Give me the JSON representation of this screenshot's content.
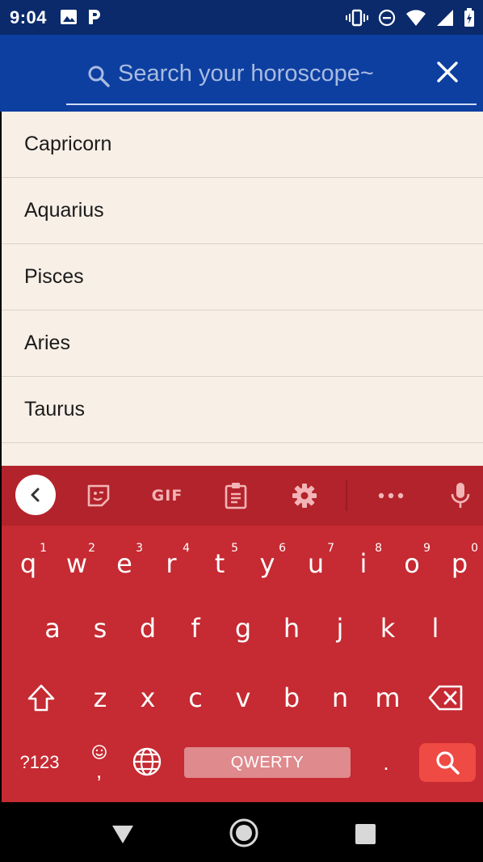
{
  "status_bar": {
    "time": "9:04",
    "left_icons": [
      "image-icon",
      "parking-p-icon"
    ],
    "right_icons": [
      "vibrate-icon",
      "do-not-disturb-icon",
      "wifi-icon",
      "signal-icon",
      "battery-charging-icon"
    ]
  },
  "search": {
    "placeholder": "Search your horoscope~",
    "value": "",
    "icon": "search-icon",
    "close_icon": "close-icon"
  },
  "results": [
    "Capricorn",
    "Aquarius",
    "Pisces",
    "Aries",
    "Taurus"
  ],
  "keyboard": {
    "toolbar": {
      "back_icon": "chevron-left-icon",
      "sticker_icon": "sticker-icon",
      "gif_label": "GIF",
      "clipboard_icon": "clipboard-icon",
      "settings_icon": "gear-icon",
      "more_icon": "more-horizontal-icon",
      "mic_icon": "mic-icon"
    },
    "row1": [
      {
        "key": "q",
        "hint": "1"
      },
      {
        "key": "w",
        "hint": "2"
      },
      {
        "key": "e",
        "hint": "3"
      },
      {
        "key": "r",
        "hint": "4"
      },
      {
        "key": "t",
        "hint": "5"
      },
      {
        "key": "y",
        "hint": "6"
      },
      {
        "key": "u",
        "hint": "7"
      },
      {
        "key": "i",
        "hint": "8"
      },
      {
        "key": "o",
        "hint": "9"
      },
      {
        "key": "p",
        "hint": "0"
      }
    ],
    "row2": [
      "a",
      "s",
      "d",
      "f",
      "g",
      "h",
      "j",
      "k",
      "l"
    ],
    "row3": [
      "z",
      "x",
      "c",
      "v",
      "b",
      "n",
      "m"
    ],
    "symbols_label": "?123",
    "space_label": "QWERTY",
    "period_label": ".",
    "comma_label": ","
  },
  "colors": {
    "status_bar": "#0a2a6b",
    "header": "#0d3fa1",
    "list_bg": "#f8efe6",
    "keyboard_bg": "#c62a32",
    "keyboard_toolbar": "#b3232b",
    "search_key": "#ef4a43"
  }
}
